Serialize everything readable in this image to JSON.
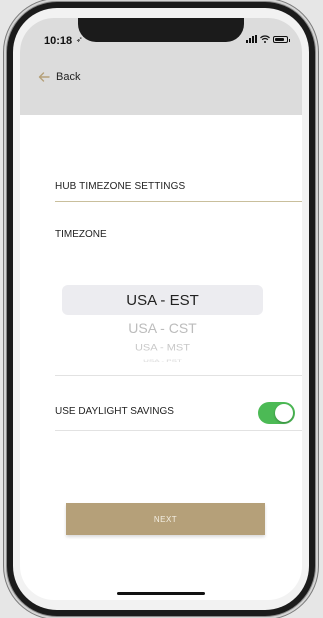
{
  "status_bar": {
    "time": "10:18",
    "location_icon": "location-arrow-icon",
    "signal_icon": "cellular-signal-icon",
    "wifi_icon": "wifi-icon",
    "battery_icon": "battery-icon"
  },
  "nav": {
    "back_label": "Back",
    "back_icon": "back-arrow-icon"
  },
  "settings": {
    "section_title": "HUB TIMEZONE SETTINGS",
    "timezone_label": "TIMEZONE",
    "timezone_options": [
      "USA - EST",
      "USA - CST",
      "USA - MST",
      "USA - PST"
    ],
    "selected_timezone": "USA - EST",
    "daylight_label": "USE DAYLIGHT SAVINGS",
    "daylight_enabled": true
  },
  "actions": {
    "next_label": "NEXT"
  },
  "colors": {
    "header_bg": "#dcdcdc",
    "accent_gold": "#b5a079",
    "toggle_on": "#4cba55",
    "divider_gold": "#c9bf9c"
  }
}
